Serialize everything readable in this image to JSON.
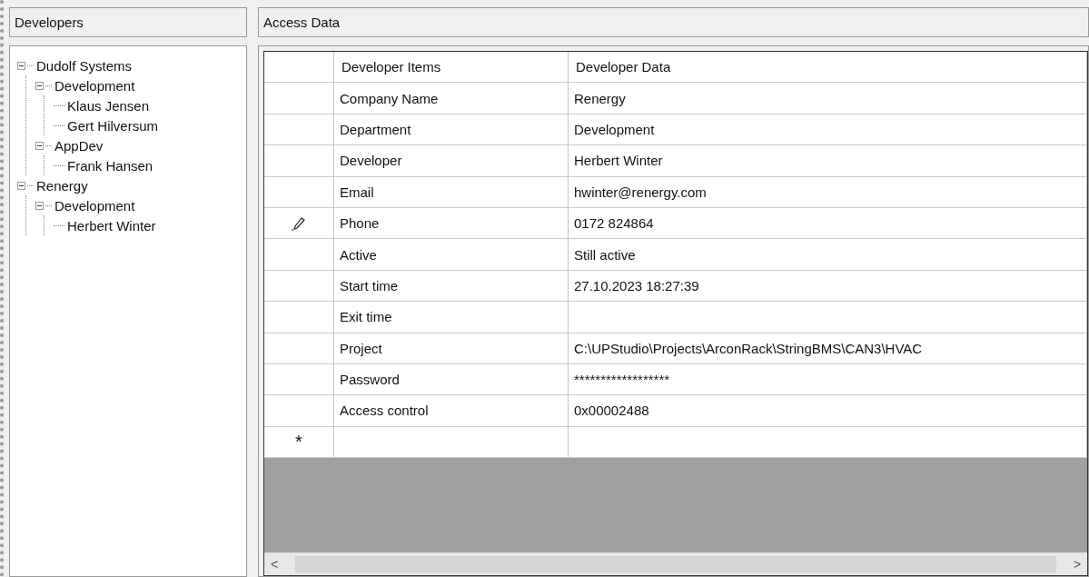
{
  "developers_panel": {
    "title": "Developers",
    "tree": [
      {
        "label": "Dudolf Systems",
        "expanded": true,
        "children": [
          {
            "label": "Development",
            "expanded": true,
            "children": [
              {
                "label": "Klaus Jensen"
              },
              {
                "label": "Gert Hilversum"
              }
            ]
          },
          {
            "label": "AppDev",
            "expanded": true,
            "children": [
              {
                "label": "Frank Hansen"
              }
            ]
          }
        ]
      },
      {
        "label": "Renergy",
        "expanded": true,
        "children": [
          {
            "label": "Development",
            "expanded": true,
            "children": [
              {
                "label": "Herbert Winter"
              }
            ]
          }
        ]
      }
    ]
  },
  "access_panel": {
    "title": "Access Data",
    "table": {
      "columns": [
        "Developer Items",
        "Developer Data"
      ],
      "rows": [
        {
          "cells": [
            "Company Name",
            "Renergy"
          ],
          "editing": false
        },
        {
          "cells": [
            "Department",
            "Development"
          ],
          "editing": false
        },
        {
          "cells": [
            "Developer",
            "Herbert Winter"
          ],
          "editing": false
        },
        {
          "cells": [
            "Email",
            "hwinter@renergy.com"
          ],
          "editing": false
        },
        {
          "cells": [
            "Phone",
            "0172 824864"
          ],
          "editing": true
        },
        {
          "cells": [
            "Active",
            "Still active"
          ],
          "editing": false
        },
        {
          "cells": [
            "Start time",
            "27.10.2023 18:27:39"
          ],
          "editing": false
        },
        {
          "cells": [
            "Exit time",
            ""
          ],
          "editing": false
        },
        {
          "cells": [
            "Project",
            "C:\\UPStudio\\Projects\\ArconRack\\StringBMS\\CAN3\\HVAC"
          ],
          "editing": false
        },
        {
          "cells": [
            "Password",
            "******************"
          ],
          "editing": false
        },
        {
          "cells": [
            "Access control",
            "0x00002488"
          ],
          "editing": false
        }
      ],
      "new_row_marker": "*",
      "scroll_left": "<",
      "scroll_right": ">"
    }
  }
}
